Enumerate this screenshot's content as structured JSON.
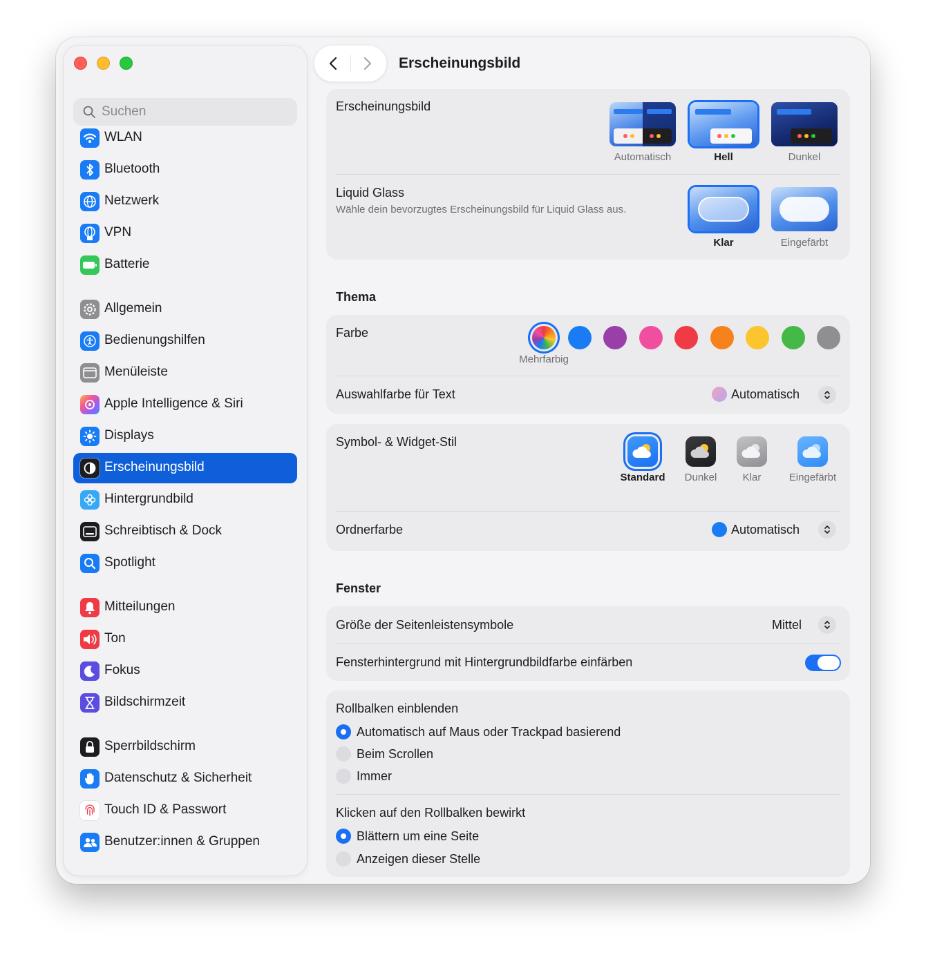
{
  "window": {
    "title": "Erscheinungsbild"
  },
  "sidebar": {
    "search_placeholder": "Suchen",
    "items": [
      {
        "label": "WLAN"
      },
      {
        "label": "Bluetooth"
      },
      {
        "label": "Netzwerk"
      },
      {
        "label": "VPN"
      },
      {
        "label": "Batterie"
      },
      {
        "label": "Allgemein"
      },
      {
        "label": "Bedienungshilfen"
      },
      {
        "label": "Menüleiste"
      },
      {
        "label": "Apple Intelligence & Siri"
      },
      {
        "label": "Displays"
      },
      {
        "label": "Erscheinungsbild",
        "active": true
      },
      {
        "label": "Hintergrundbild"
      },
      {
        "label": "Schreibtisch & Dock"
      },
      {
        "label": "Spotlight"
      },
      {
        "label": "Mitteilungen"
      },
      {
        "label": "Ton"
      },
      {
        "label": "Fokus"
      },
      {
        "label": "Bildschirmzeit"
      },
      {
        "label": "Sperrbildschirm"
      },
      {
        "label": "Datenschutz & Sicherheit"
      },
      {
        "label": "Touch ID & Passwort"
      },
      {
        "label": "Benutzer:innen & Gruppen"
      }
    ]
  },
  "appearance": {
    "label": "Erscheinungsbild",
    "options": [
      "Automatisch",
      "Hell",
      "Dunkel"
    ],
    "selected": "Hell",
    "liquid_glass": {
      "label": "Liquid Glass",
      "description": "Wähle dein bevorzugtes Erscheinungsbild für Liquid Glass aus.",
      "options": [
        "Klar",
        "Eingefärbt"
      ],
      "selected": "Klar"
    }
  },
  "theme": {
    "title": "Thema",
    "color_label": "Farbe",
    "selected_color_name": "Mehrfarbig",
    "colors": [
      "multicolor",
      "#1a7cf5",
      "#9a3fa8",
      "#f04fa0",
      "#f03a45",
      "#f7821b",
      "#fbc52e",
      "#44b948",
      "#8e8e93"
    ],
    "highlight_label": "Auswahlfarbe für Text",
    "highlight_value": "Automatisch"
  },
  "icon_style": {
    "label": "Symbol- & Widget-Stil",
    "options": [
      "Standard",
      "Dunkel",
      "Klar",
      "Eingefärbt"
    ],
    "selected": "Standard",
    "folder_label": "Ordnerfarbe",
    "folder_value": "Automatisch",
    "folder_color": "#1a7cf5"
  },
  "window_section": {
    "title": "Fenster",
    "sidebar_size_label": "Größe der Seitenleistensymbole",
    "sidebar_size_value": "Mittel",
    "tint_label": "Fensterhintergrund mit Hintergrundbildfarbe einfärben",
    "tint_on": true
  },
  "scrollbars": {
    "show_label": "Rollbalken einblenden",
    "show_options": [
      "Automatisch auf Maus oder Trackpad basierend",
      "Beim Scrollen",
      "Immer"
    ],
    "show_selected": 0,
    "click_label": "Klicken auf den Rollbalken bewirkt",
    "click_options": [
      "Blättern um eine Seite",
      "Anzeigen dieser Stelle"
    ],
    "click_selected": 0
  }
}
